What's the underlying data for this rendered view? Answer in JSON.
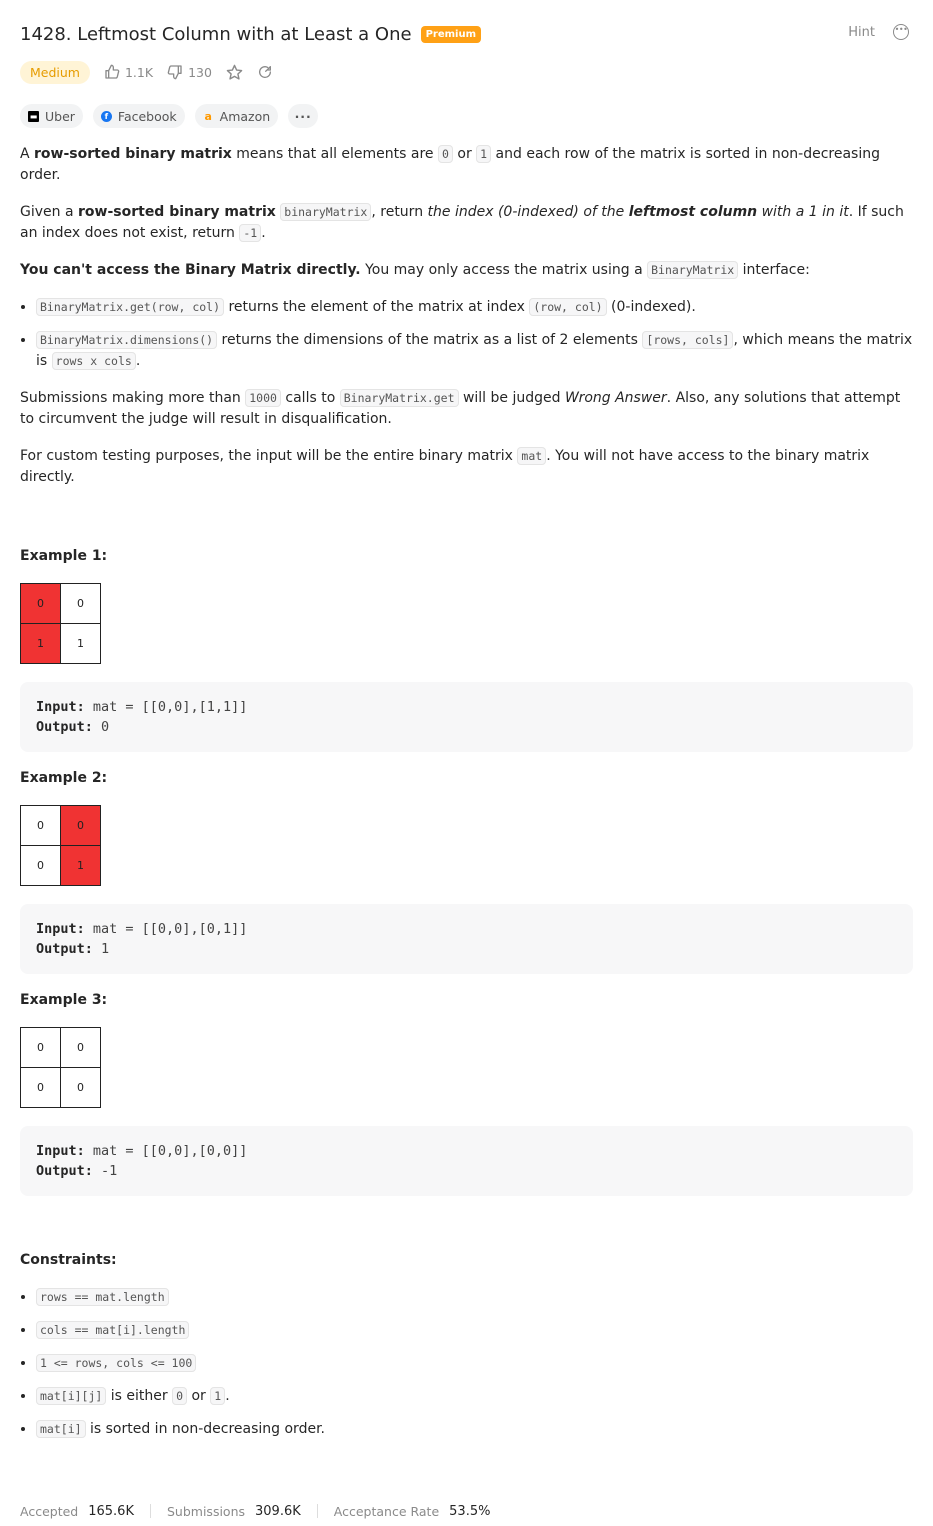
{
  "header": {
    "title": "1428. Leftmost Column with at Least a One",
    "premium_badge": "Premium",
    "hint_label": "Hint"
  },
  "meta": {
    "difficulty": "Medium",
    "likes": "1.1K",
    "dislikes": "130"
  },
  "companies": [
    "Uber",
    "Facebook",
    "Amazon"
  ],
  "description": {
    "p1": {
      "a": "A ",
      "b": "row-sorted binary matrix",
      "c": " means that all elements are ",
      "code1": "0",
      "d": " or ",
      "code2": "1",
      "e": " and each row of the matrix is sorted in non-decreasing order."
    },
    "p2": {
      "a": "Given a ",
      "b": "row-sorted binary matrix",
      "code1": "binaryMatrix",
      "c": ", return ",
      "i1": "the index (0-indexed) of the ",
      "bi": "leftmost column",
      "i2": " with a 1 in it",
      "d": ". If such an index does not exist, return ",
      "code2": "-1",
      "e": "."
    },
    "p3": {
      "b": "You can't access the Binary Matrix directly.",
      "a": " You may only access the matrix using a ",
      "code1": "BinaryMatrix",
      "c": " interface:"
    },
    "bullet1": {
      "code1": "BinaryMatrix.get(row, col)",
      "a": " returns the element of the matrix at index ",
      "code2": "(row, col)",
      "b": " (0-indexed)."
    },
    "bullet2": {
      "code1": "BinaryMatrix.dimensions()",
      "a": " returns the dimensions of the matrix as a list of 2 elements ",
      "code2": "[rows, cols]",
      "b": ", which means the matrix is ",
      "code3": "rows x cols",
      "c": "."
    },
    "p4": {
      "a": "Submissions making more than ",
      "code1": "1000",
      "b": " calls to ",
      "code2": "BinaryMatrix.get",
      "c": " will be judged ",
      "i": "Wrong Answer",
      "d": ". Also, any solutions that attempt to circumvent the judge will result in disqualification."
    },
    "p5": {
      "a": "For custom testing purposes, the input will be the entire binary matrix ",
      "code1": "mat",
      "b": ". You will not have access to the binary matrix directly."
    }
  },
  "examples": [
    {
      "title": "Example 1:",
      "grid": [
        [
          "0",
          "0"
        ],
        [
          "1",
          "1"
        ]
      ],
      "input_label": "Input:",
      "input": " mat = [[0,0],[1,1]]",
      "output_label": "Output:",
      "output": " 0"
    },
    {
      "title": "Example 2:",
      "grid": [
        [
          "0",
          "0"
        ],
        [
          "0",
          "1"
        ]
      ],
      "input_label": "Input:",
      "input": " mat = [[0,0],[0,1]]",
      "output_label": "Output:",
      "output": " 1"
    },
    {
      "title": "Example 3:",
      "grid": [
        [
          "0",
          "0"
        ],
        [
          "0",
          "0"
        ]
      ],
      "input_label": "Input:",
      "input": " mat = [[0,0],[0,0]]",
      "output_label": "Output:",
      "output": " -1"
    }
  ],
  "constraints": {
    "title": "Constraints:",
    "c1": "rows == mat.length",
    "c2": "cols == mat[i].length",
    "c3": "1 <= rows, cols <= 100",
    "c4": {
      "code1": "mat[i][j]",
      "a": " is either ",
      "code2": "0",
      "b": " or ",
      "code3": "1",
      "c": "."
    },
    "c5": {
      "code1": "mat[i]",
      "a": " is sorted in non-decreasing order."
    }
  },
  "stats": {
    "accepted_label": "Accepted",
    "accepted": "165.6K",
    "submissions_label": "Submissions",
    "submissions": "309.6K",
    "rate_label": "Acceptance Rate",
    "rate": "53.5%"
  },
  "colors": {
    "premium": "#ffa116",
    "difficulty_medium": "#e69c00",
    "highlight_cell": "#f03333"
  }
}
